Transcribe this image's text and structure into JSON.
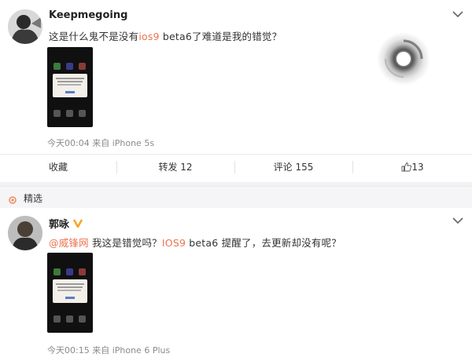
{
  "post1": {
    "username": "Keepmegoing",
    "text_before": "这是什么鬼不是没有",
    "highlight": "ios9",
    "text_after": " beta6了难道是我的错觉？",
    "meta": "今天00:04 来自 iPhone 5s"
  },
  "actions": {
    "favorite": "收藏",
    "repost": "转发 12",
    "comment": "评论 155",
    "like": "13"
  },
  "section": {
    "label": "精选"
  },
  "comment": {
    "username": "郭咏",
    "mention": "@威锋网",
    "text_mid": " 我这是错觉吗？",
    "highlight": "IOS9",
    "text_after": " beta6 提醒了，去更新却没有呢？",
    "meta": "今天00:15 来自 iPhone 6 Plus"
  },
  "colors": {
    "accent": "#eb7350",
    "muted": "#8a8a8a",
    "badge": "#f5a623"
  },
  "icons": [
    "chevron-down-icon",
    "thumbs-up-icon",
    "loading-spinner-icon",
    "verified-badge-icon",
    "section-dot-icon"
  ]
}
